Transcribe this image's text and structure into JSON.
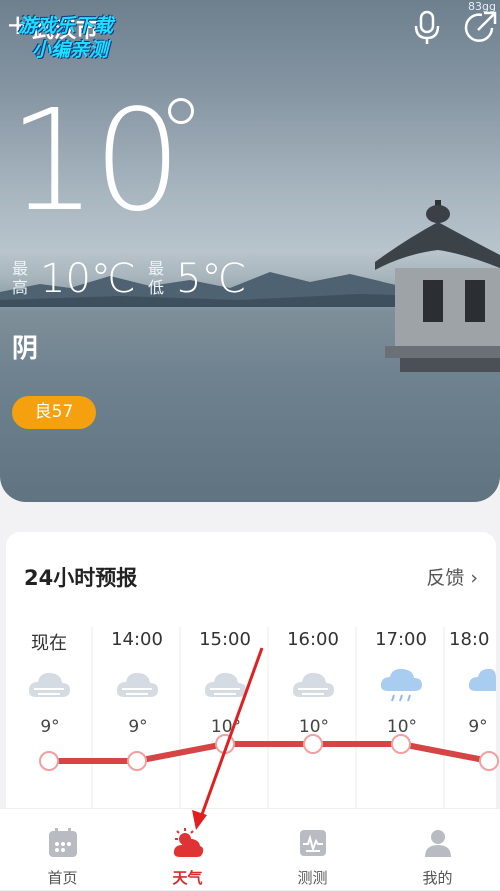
{
  "header": {
    "add_symbol": "+",
    "city": "武汉市",
    "watermark_line1": "游戏乐下载",
    "watermark_line2": "小编亲测",
    "corner_tag": "83gg"
  },
  "current": {
    "temperature": "10",
    "high_label": "最高",
    "high_value": "10℃",
    "low_label": "最低",
    "low_value": "5℃",
    "condition": "阴",
    "aqi": "良57"
  },
  "forecast": {
    "title": "24小时预报",
    "feedback": "反馈 ",
    "hours": [
      {
        "time": "现在",
        "temp": "9°",
        "icon": "cloudy-icon"
      },
      {
        "time": "14:00",
        "temp": "9°",
        "icon": "cloudy-icon"
      },
      {
        "time": "15:00",
        "temp": "10°",
        "icon": "cloudy-icon"
      },
      {
        "time": "16:00",
        "temp": "10°",
        "icon": "cloudy-icon"
      },
      {
        "time": "17:00",
        "temp": "10°",
        "icon": "rain-cloud-icon"
      },
      {
        "time": "18:0",
        "temp": "9°",
        "icon": "rain-cloud-icon"
      }
    ]
  },
  "tabs": [
    {
      "label": "首页",
      "icon": "calendar-icon",
      "active": false
    },
    {
      "label": "天气",
      "icon": "weather-icon",
      "active": true
    },
    {
      "label": "测测",
      "icon": "pulse-icon",
      "active": false
    },
    {
      "label": "我的",
      "icon": "user-icon",
      "active": false
    }
  ],
  "colors": {
    "accent": "#d92b2b",
    "aqi_badge": "#f5a00f",
    "annotation_arrow": "#e02020"
  }
}
